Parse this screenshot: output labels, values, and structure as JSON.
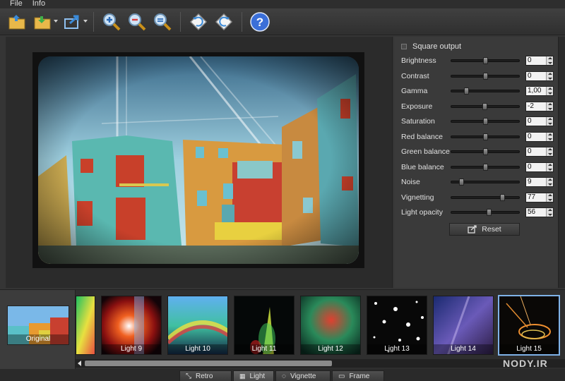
{
  "menu": {
    "file": "File",
    "info": "Info"
  },
  "toolbar": {
    "icons": [
      "open-folder-icon",
      "save-folder-icon",
      "export-icon",
      "zoom-in-icon",
      "zoom-out-icon",
      "zoom-fit-icon",
      "rotate-left-icon",
      "rotate-right-icon",
      "help-icon"
    ],
    "help_glyph": "?"
  },
  "panel": {
    "square_output": "Square output",
    "rows": [
      {
        "label": "Brightness",
        "value": "0",
        "level": 0.5
      },
      {
        "label": "Contrast",
        "value": "0",
        "level": 0.5
      },
      {
        "label": "Gamma",
        "value": "1,00",
        "level": 0.2
      },
      {
        "label": "Exposure",
        "value": "-2",
        "level": 0.49
      },
      {
        "label": "Saturation",
        "value": "0",
        "level": 0.5
      },
      {
        "label": "Red balance",
        "value": "0",
        "level": 0.5
      },
      {
        "label": "Green balance",
        "value": "0",
        "level": 0.5
      },
      {
        "label": "Blue balance",
        "value": "0",
        "level": 0.5
      },
      {
        "label": "Noise",
        "value": "9",
        "level": 0.12
      },
      {
        "label": "Vignetting",
        "value": "77",
        "level": 0.77
      },
      {
        "label": "Light opacity",
        "value": "56",
        "level": 0.56
      }
    ],
    "reset": "Reset"
  },
  "strip": {
    "original": "Original",
    "effects": [
      "Light 9",
      "Light 10",
      "Light 11",
      "Light 12",
      "Light 13",
      "Light 14",
      "Light 15"
    ],
    "selected": "Light 15"
  },
  "tabs": [
    "Retro",
    "Light",
    "Vignette",
    "Frame"
  ],
  "active_tab": "Light",
  "watermark": "NODY.IR",
  "colors": {
    "selection": "#7fb2e8",
    "help": "#3b6fd8",
    "panel": "#3a3a3a"
  }
}
